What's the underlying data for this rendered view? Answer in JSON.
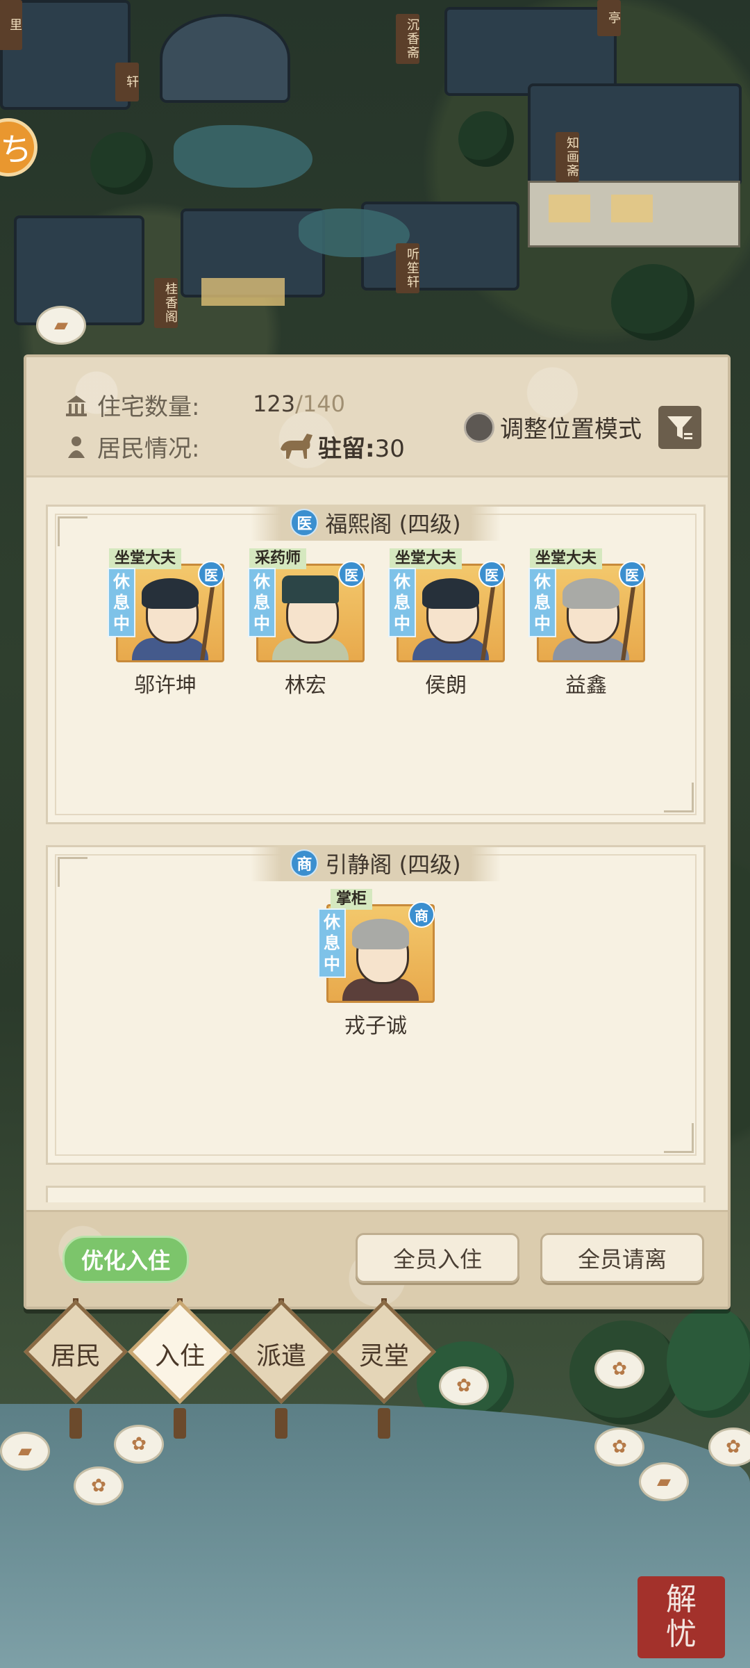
{
  "map": {
    "signs": [
      "沉香斋",
      "知画斋",
      "听笙轩",
      "桂香阁",
      "轩",
      "里",
      "亭"
    ],
    "seal_chars": [
      "解",
      "忧"
    ],
    "side_button_glyph": "ち"
  },
  "panel": {
    "housing_label": "住宅数量:",
    "housing_current": "123",
    "housing_max": "/140",
    "residents_label": "居民情况:",
    "stay_label": "驻留:",
    "stay_count": "30",
    "mode_label": "调整位置模式",
    "buildings": [
      {
        "badge": "医",
        "title": "福熙阁 (四级)",
        "residents": [
          {
            "role": "坐堂大夫",
            "status": "休息中",
            "badge": "医",
            "name": "邬许坤"
          },
          {
            "role": "采药师",
            "status": "休息中",
            "badge": "医",
            "name": "林宏"
          },
          {
            "role": "坐堂大夫",
            "status": "休息中",
            "badge": "医",
            "name": "侯朗"
          },
          {
            "role": "坐堂大夫",
            "status": "休息中",
            "badge": "医",
            "name": "益鑫"
          }
        ]
      },
      {
        "badge": "商",
        "title": "引静阁 (四级)",
        "residents": [
          {
            "role": "掌柜",
            "status": "休息中",
            "badge": "商",
            "name": "戎子诚"
          }
        ]
      }
    ],
    "optimize_label": "优化入住",
    "all_move_in_label": "全员入住",
    "all_leave_label": "全员请离"
  },
  "nav": [
    {
      "label": "居民",
      "active": false
    },
    {
      "label": "入住",
      "active": true
    },
    {
      "label": "派遣",
      "active": false
    },
    {
      "label": "灵堂",
      "active": false
    }
  ],
  "colors": {
    "medical_badge": "#3b8fcf",
    "optimize_button": "#7cc56b",
    "panel_bg": "#efe6d2",
    "seal": "#a3312b"
  },
  "icons": {
    "housing": "house-icon",
    "residents": "person-icon",
    "stay": "horse-icon",
    "filter": "filter-list-icon"
  }
}
